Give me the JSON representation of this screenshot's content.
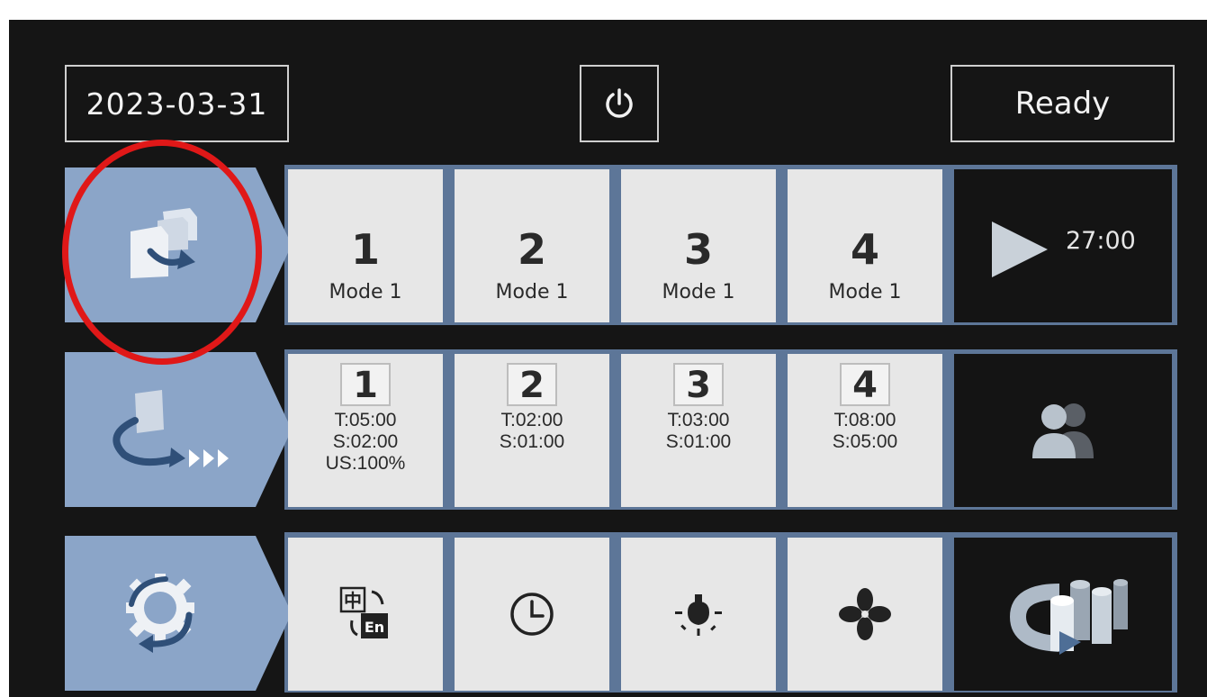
{
  "header": {
    "date": "2023-03-31",
    "status": "Ready",
    "power_icon": "power-icon"
  },
  "programs_row": {
    "side_icon": "program-transfer-icon",
    "tiles": [
      {
        "number": "1",
        "mode": "Mode 1"
      },
      {
        "number": "2",
        "mode": "Mode 1"
      },
      {
        "number": "3",
        "mode": "Mode 1"
      },
      {
        "number": "4",
        "mode": "Mode 1"
      }
    ],
    "play_icon": "play-icon",
    "timer": "27:00"
  },
  "steps_row": {
    "side_icon": "step-sequence-icon",
    "tiles": [
      {
        "number": "1",
        "lines": [
          "T:05:00",
          "S:02:00",
          "US:100%"
        ]
      },
      {
        "number": "2",
        "lines": [
          "T:02:00",
          "S:01:00"
        ]
      },
      {
        "number": "3",
        "lines": [
          "T:03:00",
          "S:01:00"
        ]
      },
      {
        "number": "4",
        "lines": [
          "T:08:00",
          "S:05:00"
        ]
      }
    ],
    "action_icon": "users-icon"
  },
  "settings_row": {
    "side_icon": "settings-cycle-icon",
    "tiles": [
      {
        "icon": "language-icon",
        "glyph_top": "中",
        "glyph_bottom": "En"
      },
      {
        "icon": "clock-icon"
      },
      {
        "icon": "lamp-icon"
      },
      {
        "icon": "fan-icon"
      }
    ],
    "action_icon": "tank-rotate-icon"
  },
  "colors": {
    "screen_bg": "#151515",
    "side_tab": "#8ba5c8",
    "row_frame": "#5d7698",
    "tile": "#e7e7e7",
    "highlight": "#e01818"
  }
}
